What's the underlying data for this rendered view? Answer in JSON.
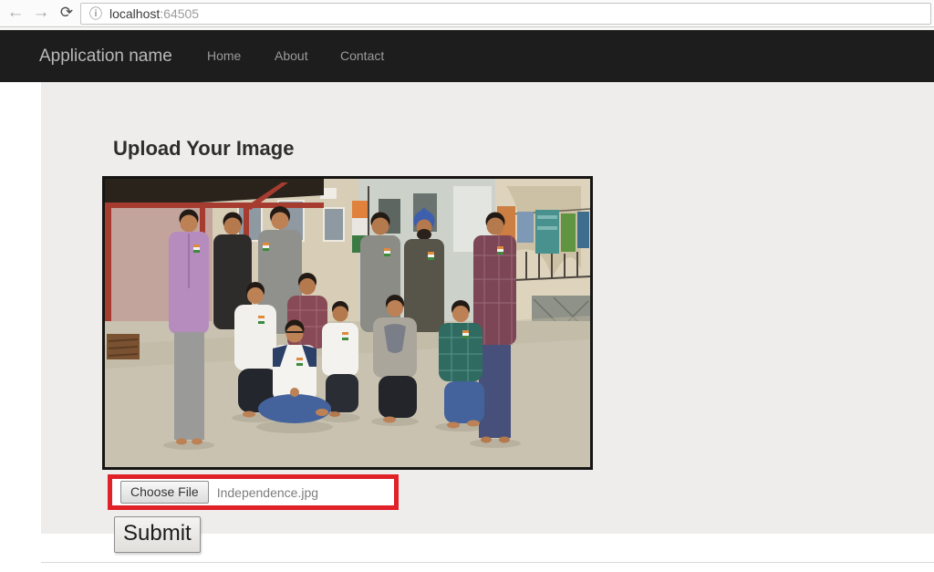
{
  "browser": {
    "back_icon": "←",
    "forward_icon": "→",
    "reload_icon": "⟳",
    "page_info_icon": "ⓘ",
    "url_host": "localhost",
    "url_port": ":64505"
  },
  "navbar": {
    "brand": "Application name",
    "items": [
      {
        "label": "Home"
      },
      {
        "label": "About"
      },
      {
        "label": "Contact"
      }
    ]
  },
  "main": {
    "heading": "Upload Your Image",
    "photo": {
      "description": "Group photograph of twelve men posing in an outdoor courtyard under a canopy with red steel posts; an Indian tricolor flag, beige buildings, hanging clothes and a fence in the background; several men wear small tricolor badges"
    },
    "file_upload": {
      "button_label": "Choose File",
      "filename": "Independence.jpg"
    },
    "submit_label": "Submit"
  },
  "colors": {
    "navbar_bg": "#1d1d1d",
    "navbar_brand": "#b9b9b9",
    "navbar_link": "#9a9a9a",
    "content_bg": "#eeedeb",
    "highlight_red": "#e02128",
    "photo_border": "#161513"
  }
}
